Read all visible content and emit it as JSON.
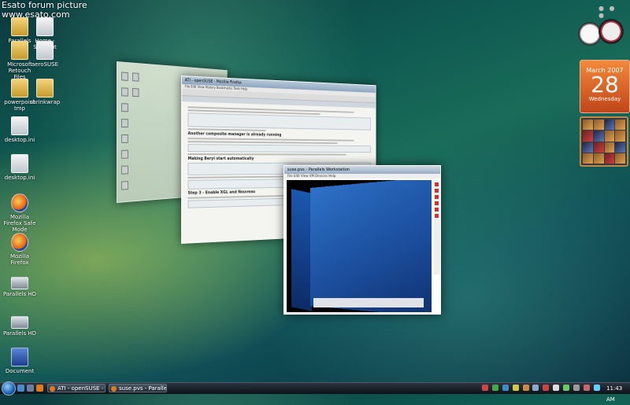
{
  "watermark": {
    "line1": "Esato forum picture",
    "line2": "www.esato.com"
  },
  "desktop": {
    "icons": [
      {
        "label": "Parallels",
        "kind": "folder"
      },
      {
        "label": "Home - Shortcut",
        "kind": "doc"
      },
      {
        "label": "Microsoft Retouch Files",
        "kind": "folder"
      },
      {
        "label": "aeroSUSE",
        "kind": "doc"
      },
      {
        "label": "powerpoint tmp",
        "kind": "folder"
      },
      {
        "label": "shrinkwrap",
        "kind": "folder"
      },
      {
        "label": "desktop.ini",
        "kind": "doc"
      },
      {
        "label": "desktop.ini",
        "kind": "doc"
      },
      {
        "label": "Mozilla Firefox Safe Mode",
        "kind": "firefox"
      },
      {
        "label": "Mozilla Firefox",
        "kind": "firefox"
      },
      {
        "label": "Parallels HD",
        "kind": "drive"
      },
      {
        "label": "Parallels HD",
        "kind": "drive"
      },
      {
        "label": "Document",
        "kind": "word"
      }
    ]
  },
  "gadgets": {
    "calendar": {
      "month": "March 2007",
      "day": "28",
      "weekday": "Wednesday"
    }
  },
  "windows": {
    "browser": {
      "title": "ATI - openSUSE - Mozilla Firefox",
      "menu": "File  Edit  View  History  Bookmarks  Tools  Help",
      "heading1": "Another composite manager is already running",
      "heading2": "Making Beryl start automatically",
      "heading3": "Step 3 - Enable XGL and Nouveau"
    },
    "vm": {
      "title": "suse.pvs - Parallels Workstation",
      "menu": "File  Edit  View  VM  Devices  Help"
    }
  },
  "taskbar": {
    "buttons": [
      {
        "label": "ATI - openSUSE - M..."
      },
      {
        "label": "suse.pvs - Parallels ..."
      }
    ],
    "clock": "11:43 AM"
  }
}
